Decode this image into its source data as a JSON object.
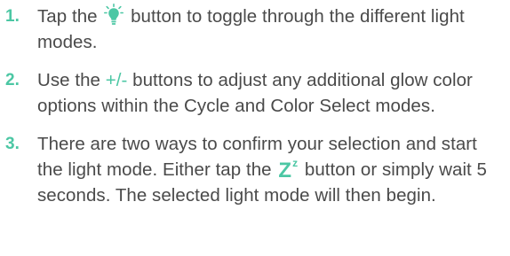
{
  "steps": [
    {
      "number": "1.",
      "before": "Tap the",
      "icon": "lightbulb-icon",
      "after": "button to toggle through the different light modes."
    },
    {
      "number": "2.",
      "before": "Use the",
      "highlight": "+/-",
      "after": "buttons to adjust any additional glow color options within the Cycle and Color Select modes."
    },
    {
      "number": "3.",
      "before": "There are two ways to confirm your selection and start the light mode. Either tap the",
      "icon": "sleep-zz-icon",
      "icon_main": "Z",
      "icon_sup": "z",
      "after": "button or simply wait 5 seconds. The selected light mode will then begin."
    }
  ],
  "colors": {
    "accent": "#4cc7a4",
    "text": "#4a4a4a"
  }
}
